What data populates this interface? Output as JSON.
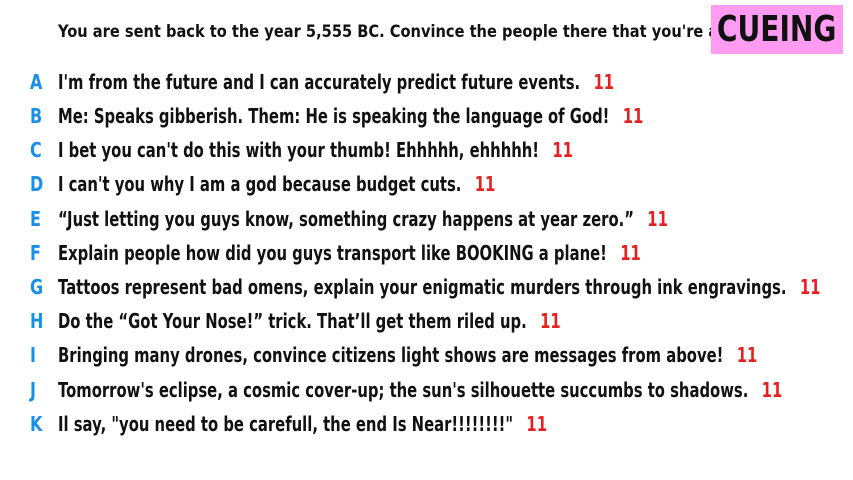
{
  "question": "You are sent back to the year 5,555 BC. Convince the people there that you're a god.",
  "badge": {
    "label": "CUEING",
    "color": "#ff9cf2"
  },
  "colors": {
    "letter": "#1a8fe6",
    "score": "#e62020"
  },
  "answers": [
    {
      "letter": "A",
      "text": "I'm from the future and I can accurately predict future events.",
      "score": "11"
    },
    {
      "letter": "B",
      "text": "Me: Speaks gibberish. Them: He is speaking the language of God!",
      "score": "11"
    },
    {
      "letter": "C",
      "text": "I bet you can't do this with your thumb! Ehhhhh, ehhhhh!",
      "score": "11"
    },
    {
      "letter": "D",
      "text": "I can't you why I am a god because budget cuts.",
      "score": "11"
    },
    {
      "letter": "E",
      "text": "“Just letting you guys know, something crazy happens at year zero.”",
      "score": "11"
    },
    {
      "letter": "F",
      "text": "Explain people how did you guys transport like BOOKING a plane!",
      "score": "11"
    },
    {
      "letter": "G",
      "text": "Tattoos represent bad omens, explain your enigmatic murders through ink engravings.",
      "score": "11"
    },
    {
      "letter": "H",
      "text": "Do the “Got Your Nose!” trick. That’ll get them riled up.",
      "score": "11"
    },
    {
      "letter": "I",
      "text": "Bringing many drones, convince citizens light shows are messages from above!",
      "score": "11"
    },
    {
      "letter": "J",
      "text": "Tomorrow's eclipse, a cosmic cover-up; the sun's silhouette succumbs to shadows.",
      "score": "11"
    },
    {
      "letter": "K",
      "text": "Il say, \"you need to be carefull, the end Is Near!!!!!!!!\"",
      "score": "11"
    }
  ]
}
